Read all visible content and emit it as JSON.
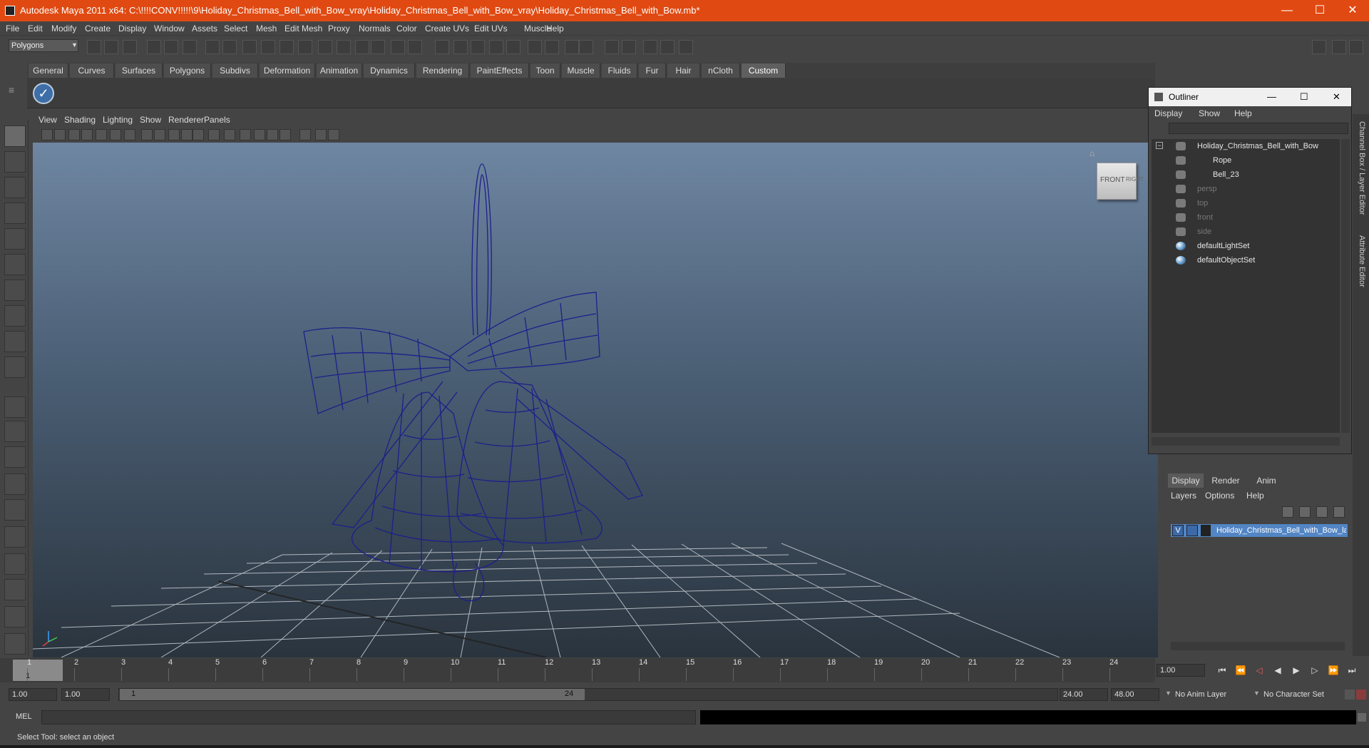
{
  "window": {
    "title": "Autodesk Maya 2011 x64: C:\\!!!!CONV!!!!!\\9\\Holiday_Christmas_Bell_with_Bow_vray\\Holiday_Christmas_Bell_with_Bow_vray\\Holiday_Christmas_Bell_with_Bow.mb*",
    "minimize": "—",
    "maximize": "☐",
    "close": "✕"
  },
  "menubar": [
    "File",
    "Edit",
    "Modify",
    "Create",
    "Display",
    "Window",
    "Assets",
    "Select",
    "Mesh",
    "Edit Mesh",
    "Proxy",
    "Normals",
    "Color",
    "Create UVs",
    "Edit UVs",
    "Muscle",
    "Help"
  ],
  "status_line": {
    "mode": "Polygons"
  },
  "shelf": {
    "tabs": [
      "General",
      "Curves",
      "Surfaces",
      "Polygons",
      "Subdivs",
      "Deformation",
      "Animation",
      "Dynamics",
      "Rendering",
      "PaintEffects",
      "Toon",
      "Muscle",
      "Fluids",
      "Fur",
      "Hair",
      "nCloth",
      "Custom"
    ],
    "active": "Custom",
    "icon": "check-icon"
  },
  "panel_menu": [
    "View",
    "Shading",
    "Lighting",
    "Show",
    "Renderer",
    "Panels"
  ],
  "viewcube": {
    "front": "FRONT",
    "right": "RIGHT"
  },
  "outliner": {
    "title": "Outliner",
    "menu": [
      "Display",
      "Show",
      "Help"
    ],
    "items": [
      {
        "label": "Holiday_Christmas_Bell_with_Bow",
        "indent": 0,
        "dim": false,
        "icon": "group-icon"
      },
      {
        "label": "Rope",
        "indent": 1,
        "dim": false,
        "icon": "mesh-icon"
      },
      {
        "label": "Bell_23",
        "indent": 1,
        "dim": false,
        "icon": "mesh-icon"
      },
      {
        "label": "persp",
        "indent": 0,
        "dim": true,
        "icon": "camera-icon"
      },
      {
        "label": "top",
        "indent": 0,
        "dim": true,
        "icon": "camera-icon"
      },
      {
        "label": "front",
        "indent": 0,
        "dim": true,
        "icon": "camera-icon"
      },
      {
        "label": "side",
        "indent": 0,
        "dim": true,
        "icon": "camera-icon"
      },
      {
        "label": "defaultLightSet",
        "indent": 0,
        "dim": false,
        "icon": "set-icon"
      },
      {
        "label": "defaultObjectSet",
        "indent": 0,
        "dim": false,
        "icon": "set-icon"
      }
    ]
  },
  "layer_editor": {
    "tabs": [
      "Display",
      "Render",
      "Anim"
    ],
    "active": "Display",
    "menu": [
      "Layers",
      "Options",
      "Help"
    ],
    "layer": {
      "visible": "V",
      "name": "Holiday_Christmas_Bell_with_Bow_layer"
    }
  },
  "side_tabs": [
    "Channel Box / Layer Editor",
    "Attribute Editor"
  ],
  "timeline": {
    "ticks": [
      "1",
      "2",
      "3",
      "4",
      "5",
      "6",
      "7",
      "8",
      "9",
      "10",
      "11",
      "12",
      "13",
      "14",
      "15",
      "16",
      "17",
      "18",
      "19",
      "20",
      "21",
      "22",
      "23",
      "24"
    ],
    "current_frame": "1",
    "current_time_field": "1.00"
  },
  "range": {
    "start": "1.00",
    "playback_start": "1.00",
    "slider_start": "1",
    "slider_end": "24",
    "playback_end": "24.00",
    "end": "48.00",
    "anim_layer": "No Anim Layer",
    "character_set": "No Character Set"
  },
  "command": {
    "label": "MEL"
  },
  "help_line": "Select Tool: select an object"
}
